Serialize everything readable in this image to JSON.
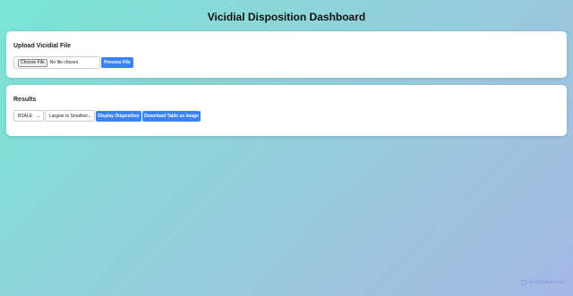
{
  "page": {
    "title": "Vicidial Disposition Dashboard"
  },
  "upload": {
    "heading": "Upload Vicidial File",
    "choose_file_label": "Choose File",
    "file_status": "No file chosen",
    "process_label": "Process File"
  },
  "results": {
    "heading": "Results",
    "disposition_select": "BSALE",
    "order_select": "Largest to Smallest",
    "display_label": "Display Disposition",
    "download_label": "Download Table as Image"
  },
  "watermark": {
    "text": "ScamMalware"
  },
  "colors": {
    "accent": "#3b82f6",
    "card": "#ffffff"
  }
}
